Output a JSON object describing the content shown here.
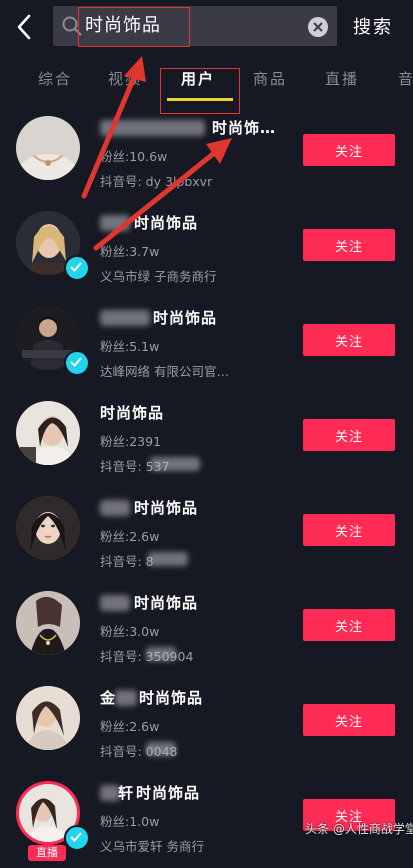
{
  "search": {
    "query": "时尚饰品",
    "action_label": "搜索"
  },
  "tabs": [
    {
      "label": "综合",
      "active": false
    },
    {
      "label": "视频",
      "active": false
    },
    {
      "label": "用户",
      "active": true
    },
    {
      "label": "商品",
      "active": false
    },
    {
      "label": "直播",
      "active": false
    },
    {
      "label": "音乐",
      "active": false
    }
  ],
  "results": [
    {
      "name": "时尚饰…",
      "fans": "粉丝:10.6w",
      "sub": "抖音号: dy   3lpbxvr",
      "verified": false,
      "live": false,
      "follow_label": "关注"
    },
    {
      "name": "时尚饰品",
      "fans": "粉丝:3.7w",
      "sub": "义乌市绿      子商务商行",
      "verified": true,
      "live": false,
      "follow_label": "关注"
    },
    {
      "name": "时尚饰品",
      "fans": "粉丝:5.1w",
      "sub": "达峰网络      有限公司官…",
      "verified": true,
      "live": false,
      "follow_label": "关注"
    },
    {
      "name": "时尚饰品",
      "fans": "粉丝:2391",
      "sub": "抖音号:        537",
      "verified": false,
      "live": false,
      "follow_label": "关注"
    },
    {
      "name": "时尚饰品",
      "fans": "粉丝:2.6w",
      "sub": "抖音号:       8",
      "verified": false,
      "live": false,
      "follow_label": "关注"
    },
    {
      "name": "时尚饰品",
      "fans": "粉丝:3.0w",
      "sub": "抖音号:     350904",
      "verified": false,
      "live": false,
      "follow_label": "关注"
    },
    {
      "name": "时尚饰品",
      "fans": "粉丝:2.6w",
      "sub": "抖音号:     0048",
      "verified": false,
      "live": false,
      "follow_label": "关注"
    },
    {
      "name": "时尚饰品",
      "fans": "粉丝:1.0w",
      "sub": "义乌市爱轩      务商行",
      "verified": true,
      "live": true,
      "live_label": "直播",
      "follow_label": "关注"
    }
  ],
  "watermark": "头条 @人性商战学堂",
  "colors": {
    "background": "#161823",
    "accent": "#fe2c55",
    "tab_indicator": "#f0d236",
    "annotation": "#e0362f",
    "verified": "#20d5ec"
  },
  "icons": [
    "back-arrow-icon",
    "search-icon",
    "clear-icon",
    "verified-icon"
  ]
}
